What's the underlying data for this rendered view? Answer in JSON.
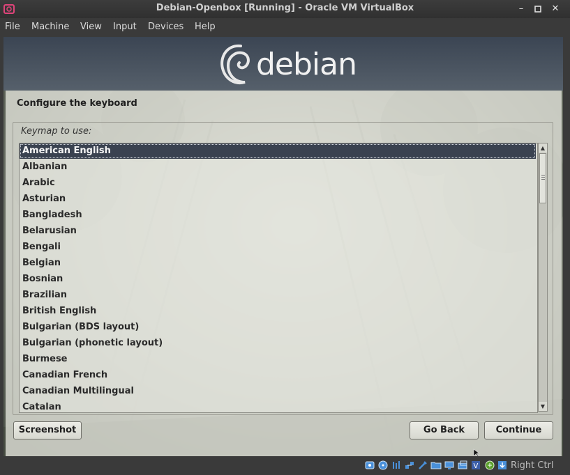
{
  "window": {
    "title": "Debian-Openbox [Running] - Oracle VM VirtualBox",
    "controls": [
      "minimize-icon",
      "maximize-icon",
      "close-icon"
    ]
  },
  "menubar": {
    "items": [
      "File",
      "Machine",
      "View",
      "Input",
      "Devices",
      "Help"
    ]
  },
  "logo": {
    "text": "debian"
  },
  "installer": {
    "title": "Configure the keyboard",
    "keymap_label": "Keymap to use:",
    "selected": "American English",
    "keymaps": [
      "American English",
      "Albanian",
      "Arabic",
      "Asturian",
      "Bangladesh",
      "Belarusian",
      "Bengali",
      "Belgian",
      "Bosnian",
      "Brazilian",
      "British English",
      "Bulgarian (BDS layout)",
      "Bulgarian (phonetic layout)",
      "Burmese",
      "Canadian French",
      "Canadian Multilingual",
      "Catalan"
    ],
    "buttons": {
      "screenshot": "Screenshot",
      "go_back": "Go Back",
      "continue": "Continue"
    }
  },
  "statusbar": {
    "icons": [
      "hard-disk-icon",
      "optical-drive-icon",
      "audio-icon",
      "network-icon",
      "usb-icon",
      "shared-folders-icon",
      "display-icon",
      "video-capture-icon",
      "virtualization-icon",
      "mouse-integration-icon",
      "keyboard-capture-icon"
    ],
    "host_key": "Right Ctrl"
  },
  "colors": {
    "selection": "#3a4250",
    "debian_red": "#d70a53",
    "title_bar": "#3a3a3a"
  }
}
